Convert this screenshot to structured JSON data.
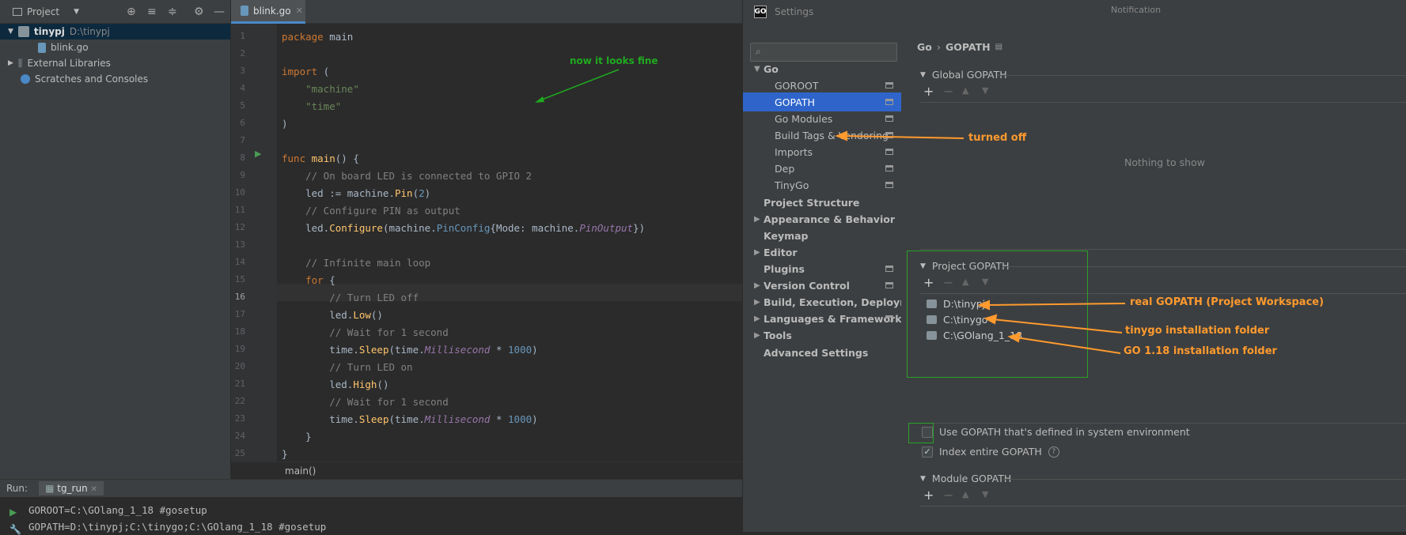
{
  "project_panel": {
    "title": "Project",
    "tree": [
      {
        "label": "tinypj",
        "path": "D:\\tinypj"
      },
      {
        "label": "blink.go"
      },
      {
        "label": "External Libraries"
      },
      {
        "label": "Scratches and Consoles"
      }
    ]
  },
  "editor": {
    "tab_label": "blink.go",
    "annotation": "now it looks fine",
    "breadcrumb": "main()",
    "line_numbers": [
      "1",
      "2",
      "3",
      "4",
      "5",
      "6",
      "7",
      "8",
      "9",
      "10",
      "11",
      "12",
      "13",
      "14",
      "15",
      "16",
      "17",
      "18",
      "19",
      "20",
      "21",
      "22",
      "23",
      "24",
      "25"
    ],
    "current_line": 16
  },
  "run": {
    "label": "Run:",
    "tab": "tg_run",
    "lines": [
      "GOROOT=C:\\GOlang_1_18 #gosetup",
      "GOPATH=D:\\tinypj;C:\\tinygo;C:\\GOlang_1_18 #gosetup"
    ]
  },
  "settings": {
    "title": "Settings",
    "search_placeholder": "",
    "nav": [
      {
        "label": "Go"
      },
      {
        "label": "GOROOT"
      },
      {
        "label": "GOPATH"
      },
      {
        "label": "Go Modules"
      },
      {
        "label": "Build Tags & Vendoring"
      },
      {
        "label": "Imports"
      },
      {
        "label": "Dep"
      },
      {
        "label": "TinyGo"
      },
      {
        "label": "Project Structure"
      },
      {
        "label": "Appearance & Behavior"
      },
      {
        "label": "Keymap"
      },
      {
        "label": "Editor"
      },
      {
        "label": "Plugins"
      },
      {
        "label": "Version Control"
      },
      {
        "label": "Build, Execution, Deployment"
      },
      {
        "label": "Languages & Frameworks"
      },
      {
        "label": "Tools"
      },
      {
        "label": "Advanced Settings"
      }
    ],
    "breadcrumb": {
      "parent": "Go",
      "sep": "›",
      "current": "GOPATH"
    },
    "global_gopath": "Global GOPATH",
    "nothing": "Nothing to show",
    "project_gopath": "Project GOPATH",
    "project_paths": [
      "D:\\tinypj",
      "C:\\tinygo",
      "C:\\GOlang_1_18"
    ],
    "use_system_env": "Use GOPATH that's defined in system environment",
    "index_entire": "Index entire GOPATH",
    "module_gopath": "Module GOPATH",
    "notifications": "Notification"
  },
  "annotations": {
    "turned_off": "turned off",
    "real_gopath": "real GOPATH (Project Workspace)",
    "tinygo": "tinygo installation folder",
    "go118": "GO 1.18 installation folder"
  },
  "colors": {
    "accent": "#2f65ca",
    "annotation_orange": "#ff9a2e",
    "annotation_green": "#2aa02a"
  }
}
